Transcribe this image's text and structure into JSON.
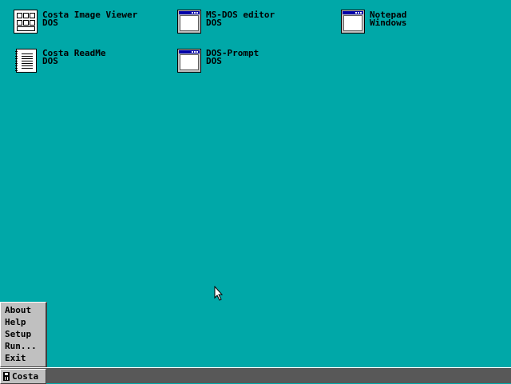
{
  "desktop": {
    "background_color": "#00A8A8",
    "icons": [
      {
        "title": "Costa Image Viewer",
        "subtitle": "DOS",
        "icon": "image-viewer-icon"
      },
      {
        "title": "MS-DOS editor",
        "subtitle": "DOS",
        "icon": "window-icon"
      },
      {
        "title": "Notepad",
        "subtitle": "Windows",
        "icon": "window-icon"
      },
      {
        "title": "Costa ReadMe",
        "subtitle": "DOS",
        "icon": "document-icon"
      },
      {
        "title": "DOS-Prompt",
        "subtitle": "DOS",
        "icon": "window-icon"
      }
    ]
  },
  "start_menu": {
    "items": [
      "About",
      "Help",
      "Setup",
      "Run...",
      "Exit"
    ]
  },
  "taskbar": {
    "start_label": "Costa",
    "background_color": "#585858"
  }
}
